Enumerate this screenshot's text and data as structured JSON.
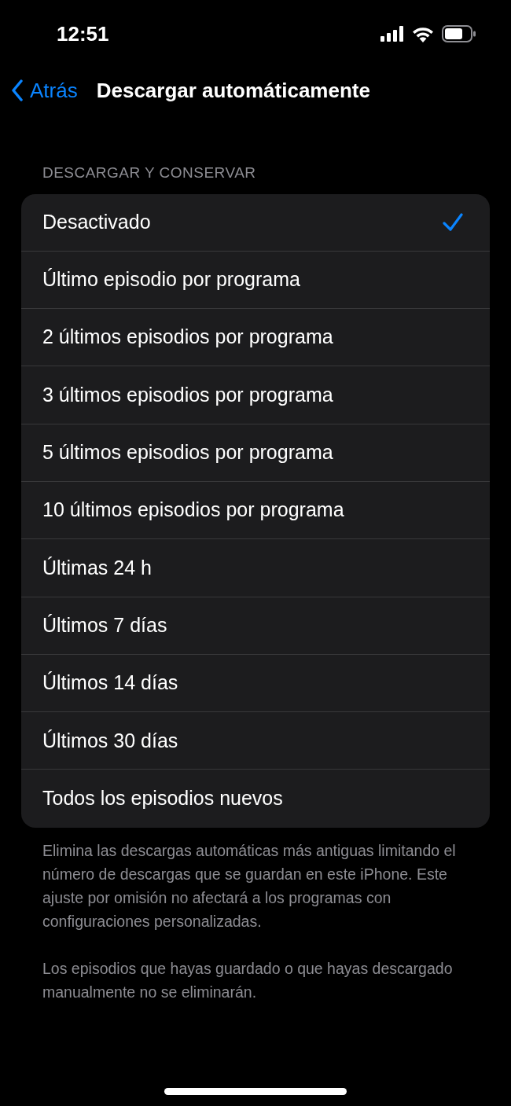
{
  "status_bar": {
    "time": "12:51"
  },
  "nav": {
    "back": "Atrás",
    "title": "Descargar automáticamente"
  },
  "section": {
    "header": "DESCARGAR Y CONSERVAR",
    "options": [
      {
        "label": "Desactivado",
        "selected": true
      },
      {
        "label": "Último episodio por programa",
        "selected": false
      },
      {
        "label": "2 últimos episodios por programa",
        "selected": false
      },
      {
        "label": "3 últimos episodios por programa",
        "selected": false
      },
      {
        "label": "5 últimos episodios por programa",
        "selected": false
      },
      {
        "label": "10 últimos episodios por programa",
        "selected": false
      },
      {
        "label": "Últimas 24 h",
        "selected": false
      },
      {
        "label": "Últimos 7 días",
        "selected": false
      },
      {
        "label": "Últimos 14 días",
        "selected": false
      },
      {
        "label": "Últimos 30 días",
        "selected": false
      },
      {
        "label": "Todos los episodios nuevos",
        "selected": false
      }
    ],
    "footer": [
      "Elimina las descargas automáticas más antiguas limitando el número de descargas que se guardan en este iPhone. Este ajuste por omisión no afectará a los programas con configuraciones personalizadas.",
      "Los episodios que hayas guardado o que hayas descargado manualmente no se eliminarán."
    ]
  }
}
